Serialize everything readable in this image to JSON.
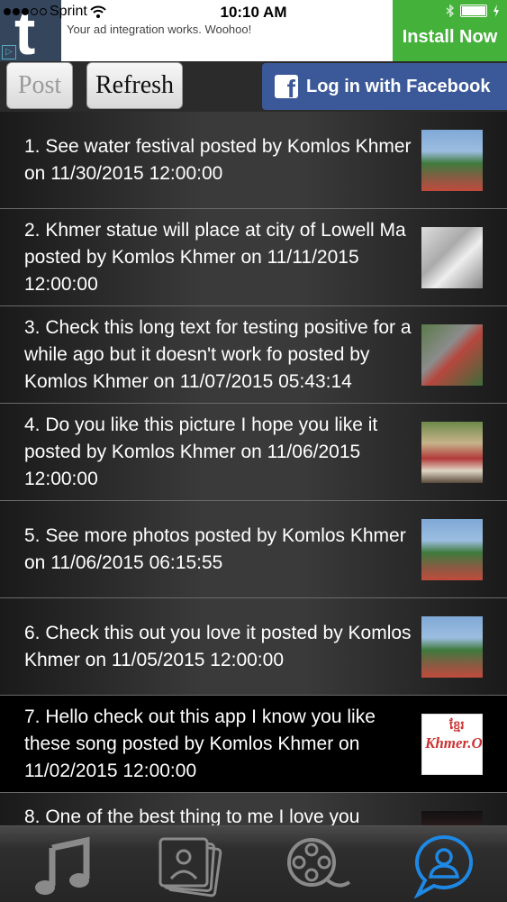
{
  "status": {
    "carrier": "Sprint",
    "time": "10:10 AM"
  },
  "ad": {
    "message": "Your ad integration works. Woohoo!",
    "install_label": "Install Now",
    "logo_letter": "t",
    "install_color": "#44b13b"
  },
  "toolbar": {
    "post_label": "Post",
    "refresh_label": "Refresh",
    "facebook_label": "Log in with Facebook",
    "facebook_color": "#3b5998"
  },
  "posts": [
    {
      "text": "1. See water festival  posted by Komlos Khmer on 11/30/2015 12:00:00"
    },
    {
      "text": "2. Khmer statue will place at city of Lowell Ma  posted by Komlos Khmer on 11/11/2015 12:00:00"
    },
    {
      "text": "3. Check this long text for testing positive for a while ago but it doesn't work fo posted by Komlos Khmer on 11/07/2015 05:43:14"
    },
    {
      "text": "4. Do you like this picture I hope you like it posted by Komlos Khmer on 11/06/2015 12:00:00"
    },
    {
      "text": "5. See more photos  posted by Komlos Khmer on 11/06/2015 06:15:55"
    },
    {
      "text": "6. Check this out you love it posted by Komlos Khmer on 11/05/2015 12:00:00"
    },
    {
      "text": "7. Hello  check out this app I know you like these song posted by Komlos Khmer on 11/02/2015 12:00:00"
    },
    {
      "text": "8. One of the best thing to me I love you"
    }
  ],
  "thumb_logo": {
    "main": "Khmer.Org",
    "top": "ខ្មែរ"
  },
  "tabs": {
    "icons": [
      "music-note-icon",
      "photos-icon",
      "film-reel-icon",
      "user-icon"
    ],
    "active": "user-icon",
    "active_color": "#1e88e5"
  }
}
